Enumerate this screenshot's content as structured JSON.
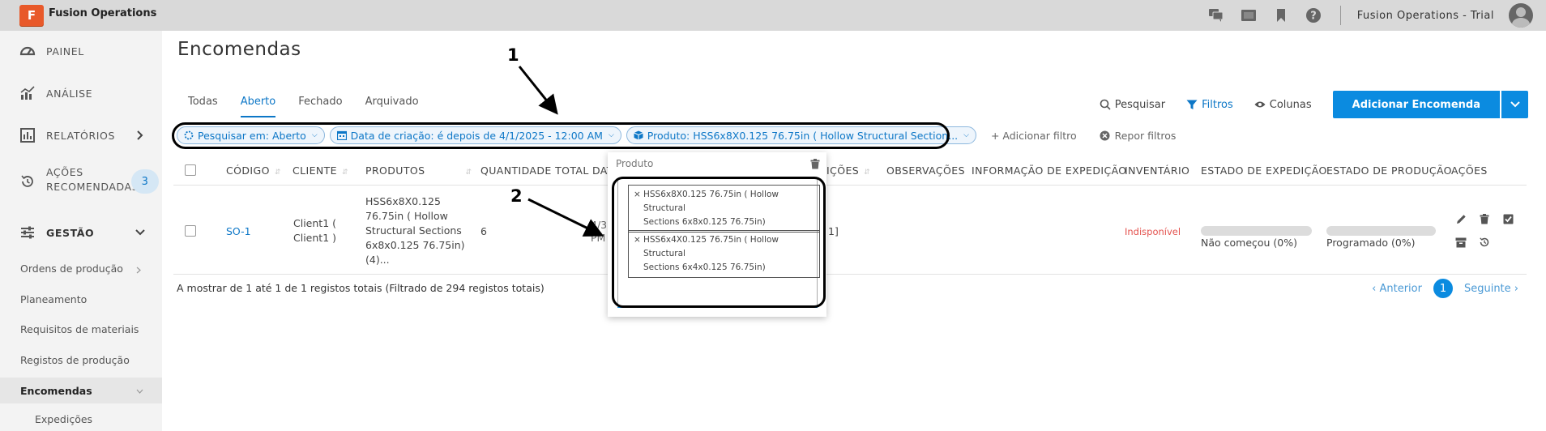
{
  "app": {
    "logo_letter": "F",
    "title": "Fusion Operations",
    "trial_label": "Fusion Operations - Trial"
  },
  "top_icons": [
    "chat-icon",
    "display-icon",
    "bookmark-icon",
    "help-icon"
  ],
  "sidebar": {
    "items": [
      {
        "label": "PAINEL",
        "icon": "dashboard-icon"
      },
      {
        "label": "ANÁLISE",
        "icon": "analytics-icon"
      },
      {
        "label": "RELATÓRIOS",
        "icon": "reports-icon"
      },
      {
        "label": "AÇÕES",
        "label2": "RECOMENDADAS",
        "icon": "history-icon",
        "badge": "3"
      },
      {
        "label": "GESTÃO",
        "icon": "sliders-icon"
      }
    ],
    "sub_items": [
      "Ordens de produção",
      "Planeamento",
      "Requisitos de materiais",
      "Registos de produção",
      "Encomendas",
      "Expedições"
    ]
  },
  "page": {
    "title": "Encomendas"
  },
  "tabs": [
    "Todas",
    "Aberto",
    "Fechado",
    "Arquivado"
  ],
  "tools": {
    "search": "Pesquisar",
    "filters": "Filtros",
    "columns": "Colunas",
    "add_button": "Adicionar Encomenda"
  },
  "filters": {
    "search_in": "Pesquisar em: Aberto",
    "created": "Data de criação: é depois de 4/1/2025 - 12:00 AM",
    "product": "Produto: HSS6x8X0.125 76.75in ( Hollow Structural Section...",
    "add": "+ Adicionar filtro",
    "reset": "Repor filtros"
  },
  "table": {
    "headers": [
      "CÓDIGO",
      "CLIENTE",
      "PRODUTOS",
      "QUANTIDADE TOTAL",
      "DAT",
      "IÇÕES",
      "OBSERVAÇÕES",
      "INFORMAÇÃO DE EXPEDIÇÃO",
      "INVENTÁRIO",
      "ESTADO DE EXPEDIÇÃO",
      "ESTADO DE PRODUÇÃO",
      "AÇÕES"
    ],
    "row": {
      "code": "SO-1",
      "client": [
        "Client1 (",
        "Client1 )"
      ],
      "products": [
        "HSS6x8X0.125",
        "76.75in ( Hollow",
        "Structural Sections",
        "6x8x0.125 76.75in)",
        "(4)..."
      ],
      "quantity": "6",
      "date_partial": [
        "4/3",
        "PM"
      ],
      "col_partial": "1]",
      "inventory": "Indisponível",
      "shipping_status": "Não começou (0%)",
      "shipping_progress": 0,
      "production_status": "Programado (0%)",
      "production_progress": 0
    }
  },
  "footer": {
    "summary": "A mostrar de 1 até 1 de 1 registos totais (Filtrado de 294 registos totais)",
    "prev": "‹ Anterior",
    "page": "1",
    "next": "Seguinte ›"
  },
  "dropdown": {
    "title": "Produto",
    "tags": [
      [
        "HSS6x8X0.125 76.75in ( Hollow Structural",
        "Sections 6x8x0.125 76.75in)"
      ],
      [
        "HSS6x4X0.125 76.75in ( Hollow Structural",
        "Sections 6x4x0.125 76.75in)"
      ]
    ]
  },
  "annotations": {
    "one": "1",
    "two": "2"
  },
  "colors": {
    "accent": "#0b8be0",
    "logo": "#e8592a",
    "unavailable": "#e4534f"
  }
}
